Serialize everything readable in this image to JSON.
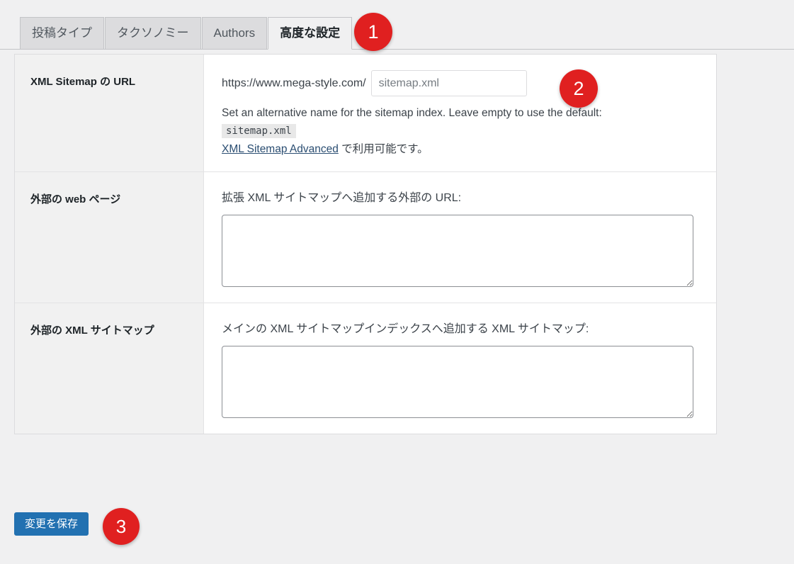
{
  "tabs": [
    {
      "label": "投稿タイプ",
      "active": false
    },
    {
      "label": "タクソノミー",
      "active": false
    },
    {
      "label": "Authors",
      "active": false
    },
    {
      "label": "高度な設定",
      "active": true
    }
  ],
  "rows": {
    "sitemap_url": {
      "label": "XML Sitemap の URL",
      "url_prefix": "https://www.mega-style.com/",
      "input_value": "sitemap.xml",
      "input_placeholder": "sitemap.xml",
      "help_text": "Set an alternative name for the sitemap index. Leave empty to use the default:",
      "default_code": "sitemap.xml",
      "link_label": "XML Sitemap Advanced",
      "availability_suffix": " で利用可能です。"
    },
    "external_pages": {
      "label": "外部の web ページ",
      "caption": "拡張 XML サイトマップへ追加する外部の URL:",
      "textarea_value": "",
      "textarea_placeholder": ""
    },
    "external_sitemaps": {
      "label": "外部の XML サイトマップ",
      "caption": "メインの XML サイトマップインデックスへ追加する XML サイトマップ:",
      "textarea_value": "",
      "textarea_placeholder": ""
    }
  },
  "save_button": {
    "label": "変更を保存"
  },
  "badges": [
    {
      "number": "1"
    },
    {
      "number": "2"
    },
    {
      "number": "3"
    }
  ],
  "colors": {
    "page_background": "#f0f0f1",
    "tab_inactive": "#dcdcde",
    "tab_active": "#f0f0f1",
    "label_column": "#f1f1f1",
    "field_background": "#ffffff",
    "primary_button": "#2271b1",
    "badge_red": "#e02020",
    "link_blue": "#2b4e72",
    "border_grey": "#c3c4c7"
  }
}
